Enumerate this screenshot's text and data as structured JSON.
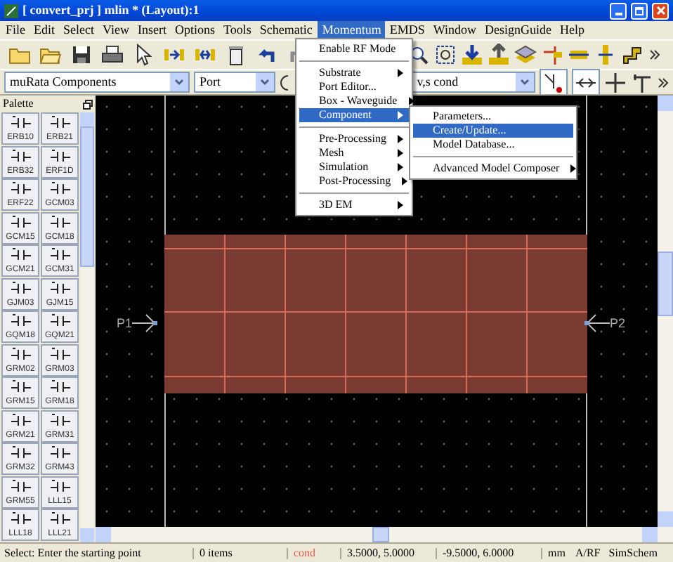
{
  "window": {
    "title": "[ convert_prj ] mlin * (Layout):1"
  },
  "menu_bar": [
    {
      "label": "File",
      "selected": false
    },
    {
      "label": "Edit",
      "selected": false
    },
    {
      "label": "Select",
      "selected": false
    },
    {
      "label": "View",
      "selected": false
    },
    {
      "label": "Insert",
      "selected": false
    },
    {
      "label": "Options",
      "selected": false
    },
    {
      "label": "Tools",
      "selected": false
    },
    {
      "label": "Schematic",
      "selected": false
    },
    {
      "label": "Momentum",
      "selected": true
    },
    {
      "label": "EMDS",
      "selected": false
    },
    {
      "label": "Window",
      "selected": false
    },
    {
      "label": "DesignGuide",
      "selected": false
    },
    {
      "label": "Help",
      "selected": false
    }
  ],
  "momentum_menu": [
    {
      "kind": "item",
      "label": "Enable RF Mode",
      "submenu": false,
      "selected": false
    },
    {
      "kind": "separator"
    },
    {
      "kind": "item",
      "label": "Substrate",
      "submenu": true,
      "selected": false
    },
    {
      "kind": "item",
      "label": "Port Editor...",
      "submenu": false,
      "selected": false
    },
    {
      "kind": "item",
      "label": "Box - Waveguide",
      "submenu": true,
      "selected": false
    },
    {
      "kind": "item",
      "label": "Component",
      "submenu": true,
      "selected": true
    },
    {
      "kind": "separator"
    },
    {
      "kind": "item",
      "label": "Pre-Processing",
      "submenu": true,
      "selected": false
    },
    {
      "kind": "item",
      "label": "Mesh",
      "submenu": true,
      "selected": false
    },
    {
      "kind": "item",
      "label": "Simulation",
      "submenu": true,
      "selected": false
    },
    {
      "kind": "item",
      "label": "Post-Processing",
      "submenu": true,
      "selected": false
    },
    {
      "kind": "separator"
    },
    {
      "kind": "item",
      "label": "3D EM",
      "submenu": true,
      "selected": false
    }
  ],
  "component_submenu": [
    {
      "kind": "item",
      "label": "Parameters...",
      "submenu": false,
      "selected": false
    },
    {
      "kind": "item",
      "label": "Create/Update...",
      "submenu": false,
      "selected": true
    },
    {
      "kind": "item",
      "label": "Model Database...",
      "submenu": false,
      "selected": false
    },
    {
      "kind": "separator"
    },
    {
      "kind": "item",
      "label": "Advanced Model Composer",
      "submenu": true,
      "selected": false
    }
  ],
  "toolbar": {
    "component_library": "muRata Components",
    "component": "Port",
    "layer": "v,s cond"
  },
  "palette": {
    "title": "Palette",
    "items": [
      "ERB10",
      "ERB21",
      "ERB32",
      "ERF1D",
      "ERF22",
      "GCM03",
      "GCM15",
      "GCM18",
      "GCM21",
      "GCM31",
      "GJM03",
      "GJM15",
      "GQM18",
      "GQM21",
      "GRM02",
      "GRM03",
      "GRM15",
      "GRM18",
      "GRM21",
      "GRM31",
      "GRM32",
      "GRM43",
      "GRM55",
      "LLL15",
      "LLL18",
      "LLL21"
    ]
  },
  "layout": {
    "ports": [
      {
        "label": "P1"
      },
      {
        "label": "P2"
      }
    ]
  },
  "status_bar": {
    "prompt": "Select: Enter the starting point",
    "items": "0 items",
    "layer": "cond",
    "cursor": "3.5000, 5.0000",
    "offset": "-9.5000, 6.0000",
    "units": "mm",
    "mode": "A/RF",
    "simulator": "SimSchem"
  }
}
